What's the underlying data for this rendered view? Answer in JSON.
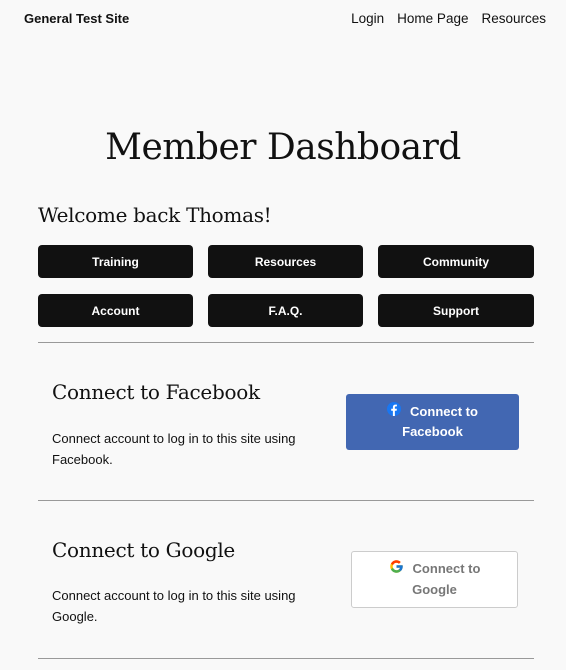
{
  "header": {
    "site_title": "General Test Site",
    "nav": [
      "Login",
      "Home Page",
      "Resources"
    ]
  },
  "page": {
    "title": "Member Dashboard",
    "welcome": "Welcome back Thomas!"
  },
  "dashboard_buttons": [
    "Training",
    "Resources",
    "Community",
    "Account",
    "F.A.Q.",
    "Support"
  ],
  "facebook": {
    "title": "Connect to Facebook",
    "description": "Connect account to log in to this site using Facebook.",
    "button_line1": "Connect to",
    "button_line2": "Facebook",
    "icon": "facebook-icon",
    "color": "#4267b2"
  },
  "google": {
    "title": "Connect to Google",
    "description": "Connect account to log in to this site using Google.",
    "button_line1": "Connect to",
    "button_line2": "Google",
    "icon": "google-icon"
  }
}
